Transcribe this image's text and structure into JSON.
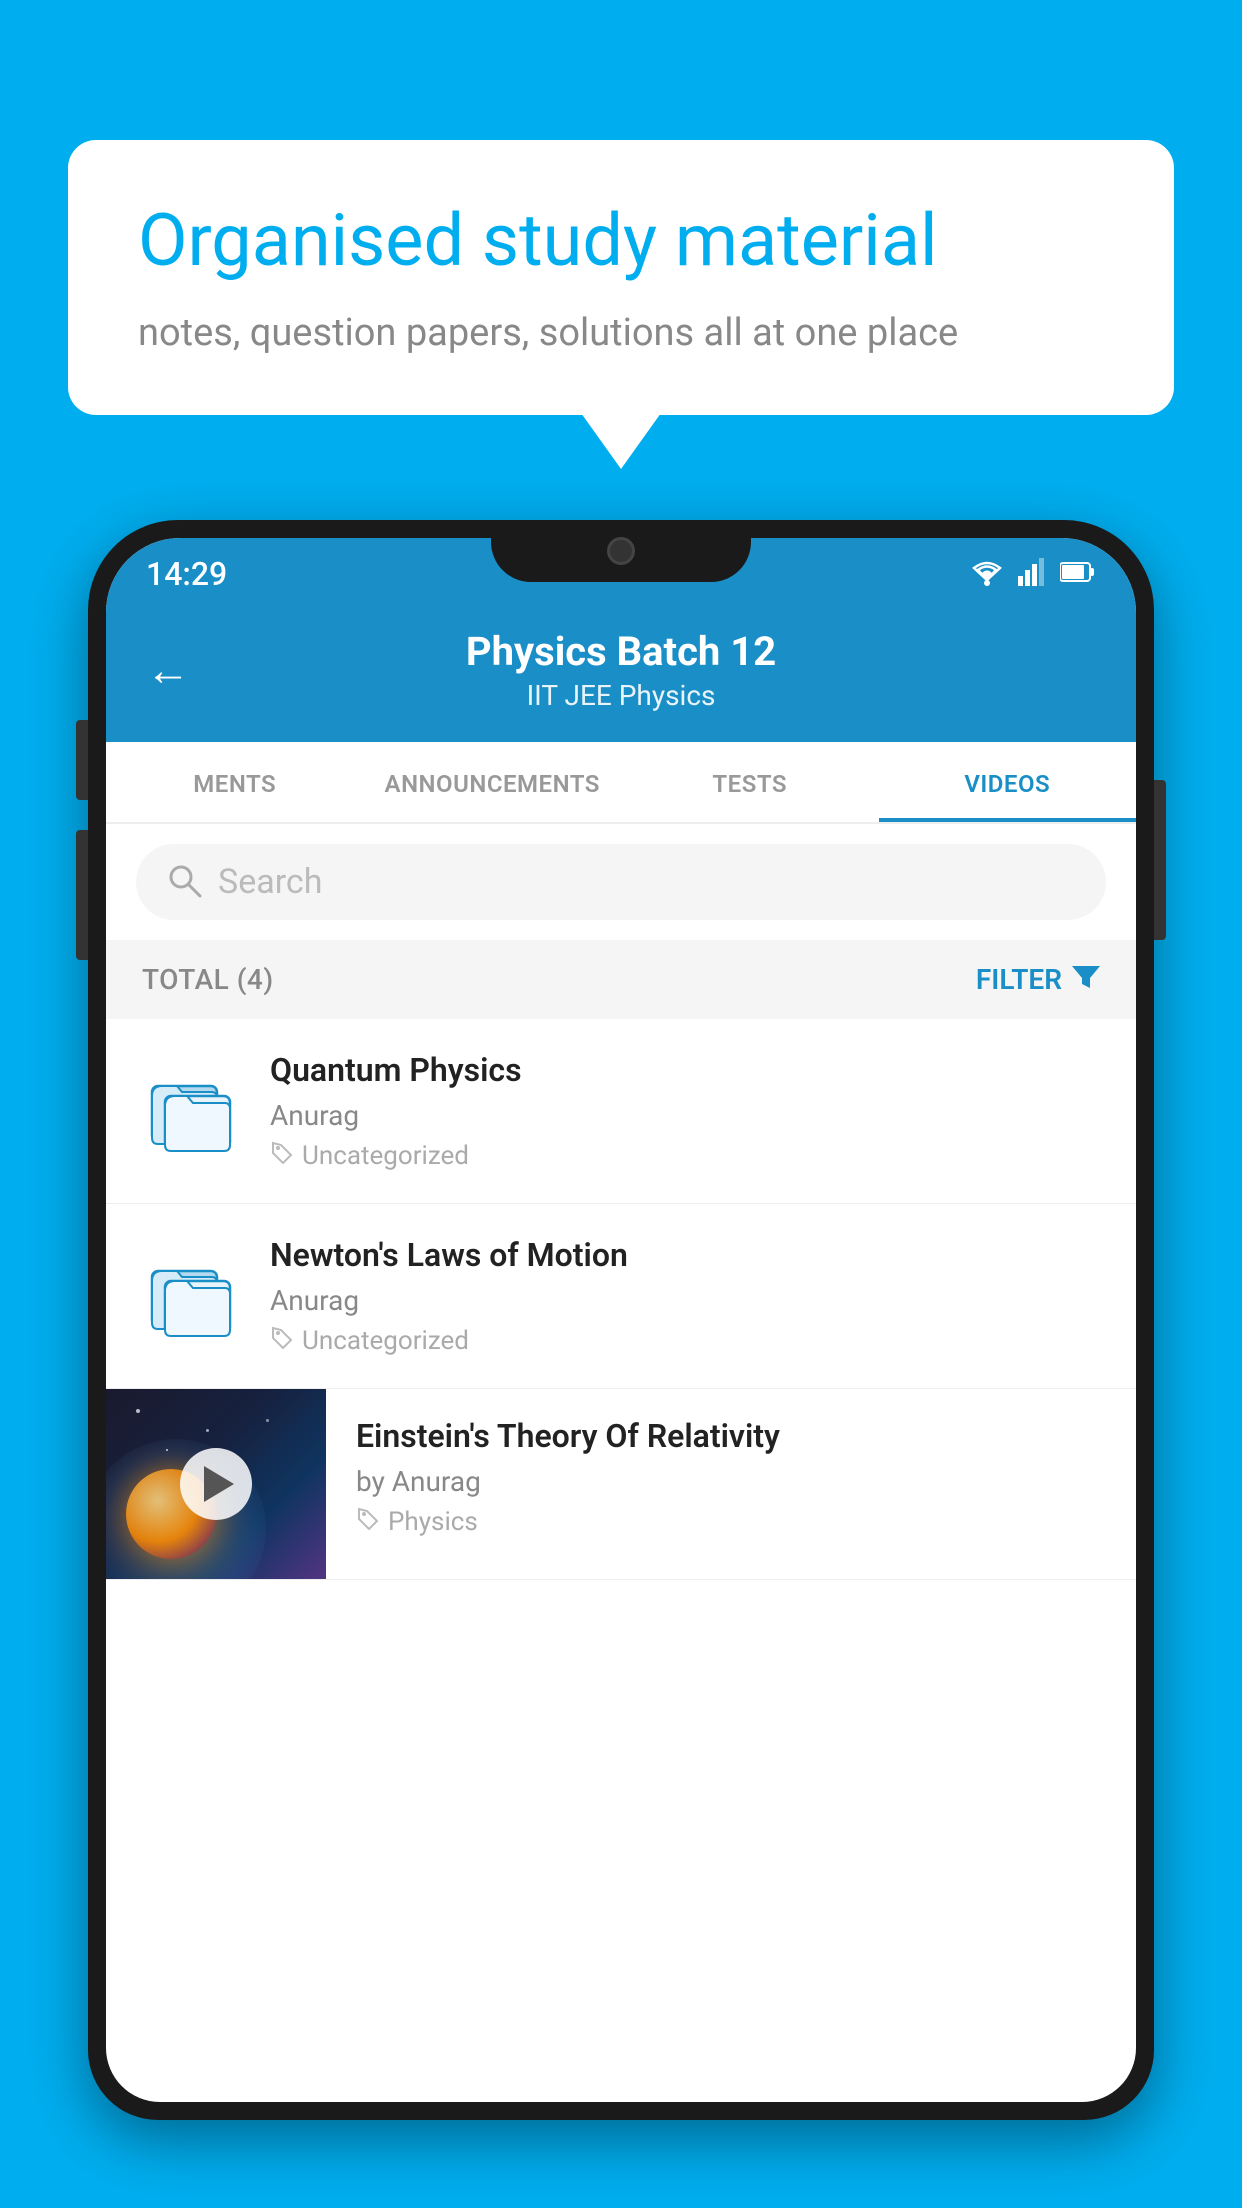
{
  "background": {
    "color": "#00AEEF"
  },
  "speech_bubble": {
    "title": "Organised study material",
    "subtitle": "notes, question papers, solutions all at one place"
  },
  "status_bar": {
    "time": "14:29",
    "wifi": "▾",
    "signal": "▴",
    "battery": "▮"
  },
  "header": {
    "back_label": "←",
    "title": "Physics Batch 12",
    "subtitle_part1": "IIT JEE",
    "subtitle_sep": "   ",
    "subtitle_part2": "Physics"
  },
  "tabs": [
    {
      "label": "MENTS",
      "active": false
    },
    {
      "label": "ANNOUNCEMENTS",
      "active": false
    },
    {
      "label": "TESTS",
      "active": false
    },
    {
      "label": "VIDEOS",
      "active": true
    }
  ],
  "search": {
    "placeholder": "Search"
  },
  "filter_bar": {
    "total_label": "TOTAL (4)",
    "filter_label": "FILTER"
  },
  "videos": [
    {
      "id": 1,
      "title": "Quantum Physics",
      "author": "Anurag",
      "tag": "Uncategorized",
      "type": "folder",
      "has_thumbnail": false
    },
    {
      "id": 2,
      "title": "Newton's Laws of Motion",
      "author": "Anurag",
      "tag": "Uncategorized",
      "type": "folder",
      "has_thumbnail": false
    },
    {
      "id": 3,
      "title": "Einstein's Theory Of Relativity",
      "author": "by Anurag",
      "tag": "Physics",
      "type": "video",
      "has_thumbnail": true
    }
  ]
}
